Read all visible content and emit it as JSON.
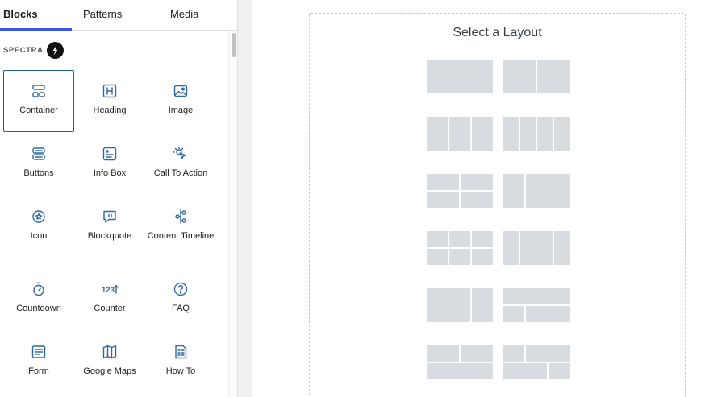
{
  "tabs": {
    "blocks": "Blocks",
    "patterns": "Patterns",
    "media": "Media"
  },
  "category": {
    "label": "SPECTRA",
    "logo_icon": "spectra-logo-icon"
  },
  "blocks": [
    {
      "label": "Container",
      "icon": "container-icon"
    },
    {
      "label": "Heading",
      "icon": "heading-icon"
    },
    {
      "label": "Image",
      "icon": "image-icon"
    },
    {
      "label": "Buttons",
      "icon": "buttons-icon"
    },
    {
      "label": "Info Box",
      "icon": "info-box-icon"
    },
    {
      "label": "Call To Action",
      "icon": "call-to-action-icon"
    },
    {
      "label": "Icon",
      "icon": "icon-block-icon"
    },
    {
      "label": "Blockquote",
      "icon": "blockquote-icon"
    },
    {
      "label": "Content Timeline",
      "icon": "content-timeline-icon"
    },
    {
      "label": "Countdown",
      "icon": "countdown-icon"
    },
    {
      "label": "Counter",
      "icon": "counter-icon",
      "glyph": "123"
    },
    {
      "label": "FAQ",
      "icon": "faq-icon"
    },
    {
      "label": "Form",
      "icon": "form-icon"
    },
    {
      "label": "Google Maps",
      "icon": "google-maps-icon"
    },
    {
      "label": "How To",
      "icon": "how-to-icon"
    }
  ],
  "selected_block": "Container",
  "canvas": {
    "title": "Select a Layout"
  },
  "colors": {
    "accent": "#3858e9",
    "selected_border": "#1e5fa0",
    "icon_blue": "#2d6aa3",
    "layout_cell": "#d8dbdf"
  }
}
